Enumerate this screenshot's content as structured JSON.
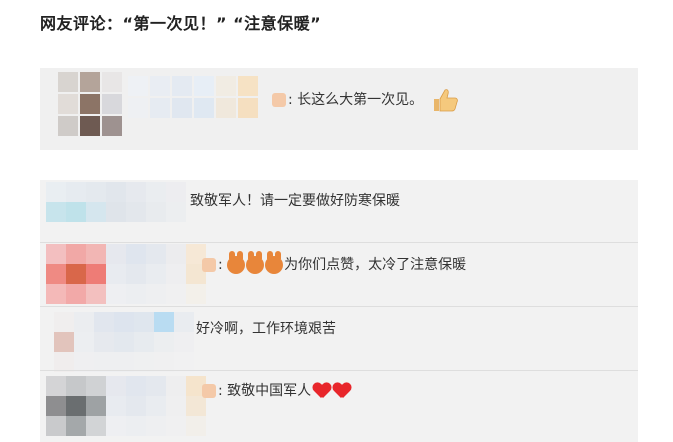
{
  "heading": "网友评论：“第一次见！” “注意保暖”",
  "comments": [
    {
      "text": "长这么大第一次见。",
      "emoji": "thumbs-up-icon"
    },
    {
      "text": "致敬军人！请一定要做好防寒保暖"
    },
    {
      "text": "为你们点赞，太冷了注意保暖",
      "emoji": "orange-cheer-icon"
    },
    {
      "text": "好冷啊，工作环境艰苦"
    },
    {
      "text": "致敬中国军人",
      "emoji": "red-heart-icon"
    }
  ],
  "colors": {
    "card_bg": "#f0f0f0",
    "heart": "#e8262b"
  }
}
